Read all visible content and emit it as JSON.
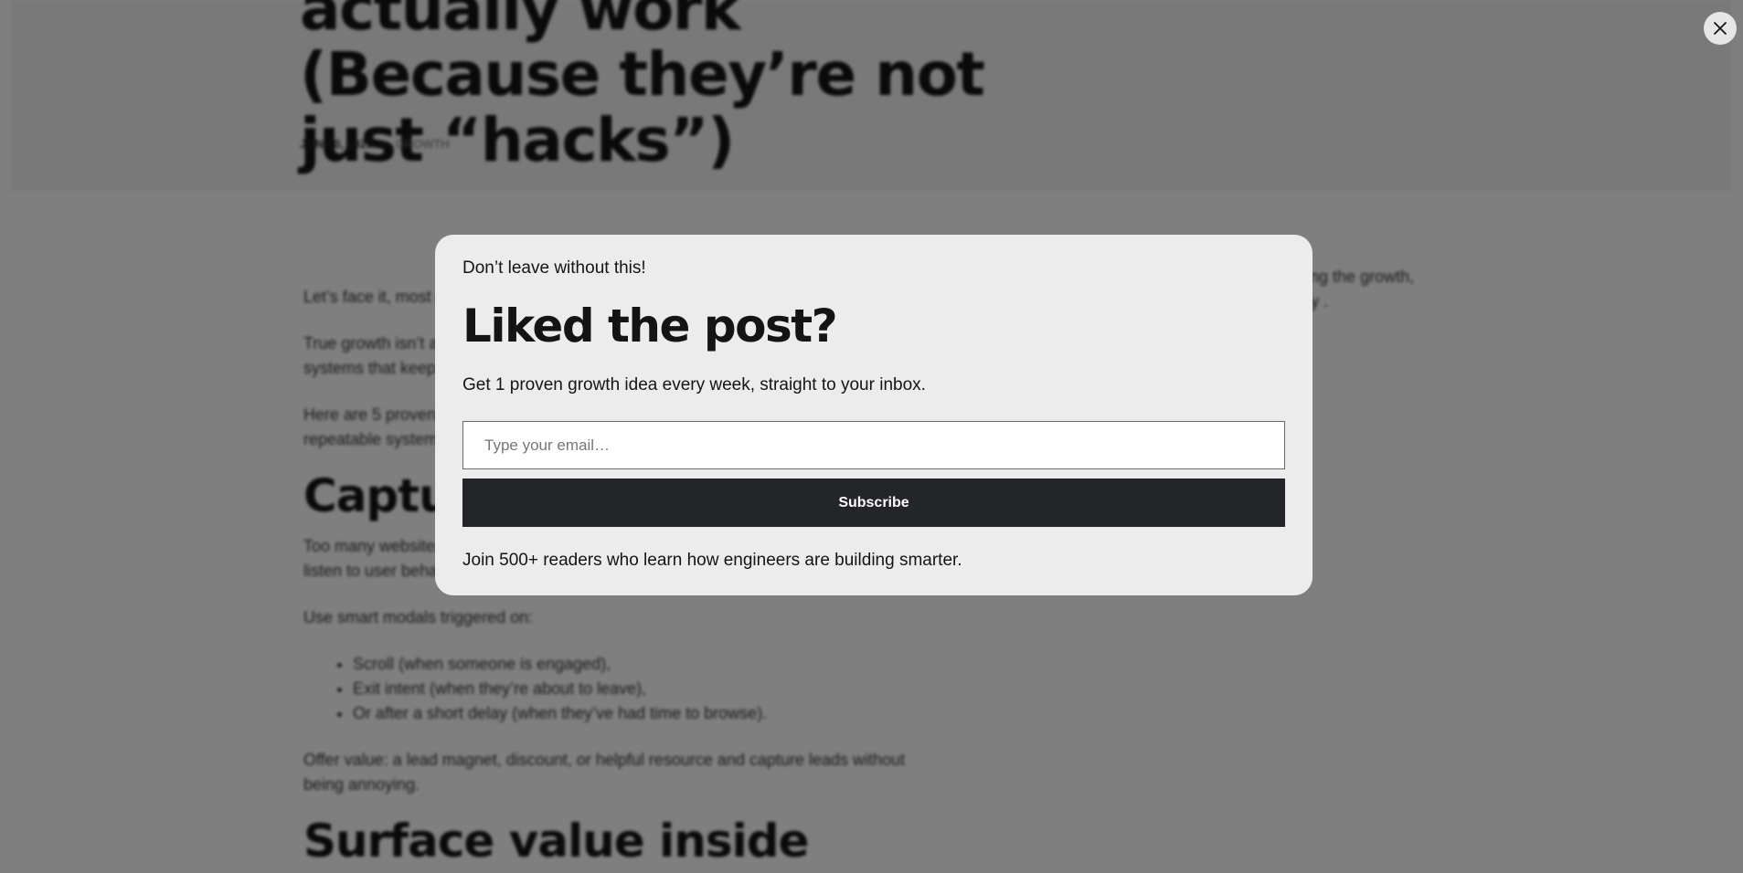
{
  "article": {
    "title": "actually work (Because they’re not just “hacks”)",
    "date": "JUN 30, 2025",
    "separator": "·",
    "category": "GROWTH",
    "paragraphs": [
      "Let’s face it, most growth tactics feel like quick tricks that rarely deliver lasting value.",
      "True growth isn’t about hacks or shortcuts that fade after a week. It’s about building systems that keep working long after launch.",
      "Here are 5 proven strategies rooted in real user behavior, psychology, and repeatable systems."
    ],
    "heading_1": "Capture leads with smart modals",
    "paragraph_4": "Too many websites interrupt visitors at the wrong moment. It works better when you listen to user behavior.",
    "paragraph_5": "Use smart modals triggered on:",
    "bullets": [
      "Scroll (when someone is engaged),",
      "Exit intent (when they’re about to leave),",
      "Or after a short delay (when they’ve had time to browse)."
    ],
    "paragraph_6": "Offer value: a lead magnet, discount, or helpful resource and capture leads without being annoying.",
    "heading_2": "Surface value inside",
    "side_text": "exploring the growth, recently ."
  },
  "modal": {
    "eyebrow": "Don’t leave without this!",
    "title": "Liked the post?",
    "subtitle": "Get 1 proven growth idea every week, straight to your inbox.",
    "email_placeholder": "Type your email…",
    "subscribe_label": "Subscribe",
    "footer": "Join 500+ readers who learn how engineers are building smarter."
  },
  "icons": {
    "close": "close-icon"
  }
}
